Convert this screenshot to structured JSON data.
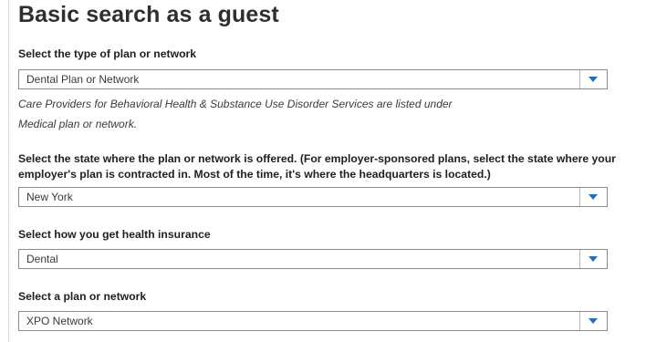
{
  "page": {
    "title": "Basic search as a guest"
  },
  "plan_type": {
    "label": "Select the type of plan or network",
    "value": "Dental Plan or Network"
  },
  "note": {
    "line1": "Care Providers for Behavioral Health & Substance Use Disorder Services are listed under",
    "line2": "Medical plan or network."
  },
  "state": {
    "label": "Select the state where the plan or network is offered. (For employer-sponsored plans, select the state where your employer's plan is contracted in. Most of the time, it's where the headquarters is located.)",
    "value": "New York"
  },
  "insurance": {
    "label": "Select how you get health insurance",
    "value": "Dental"
  },
  "network": {
    "label": "Select a plan or network",
    "value": "XPO Network"
  },
  "icons": {
    "dropdown": "chevron-down-icon",
    "accent_color": "#1a6fc6"
  }
}
